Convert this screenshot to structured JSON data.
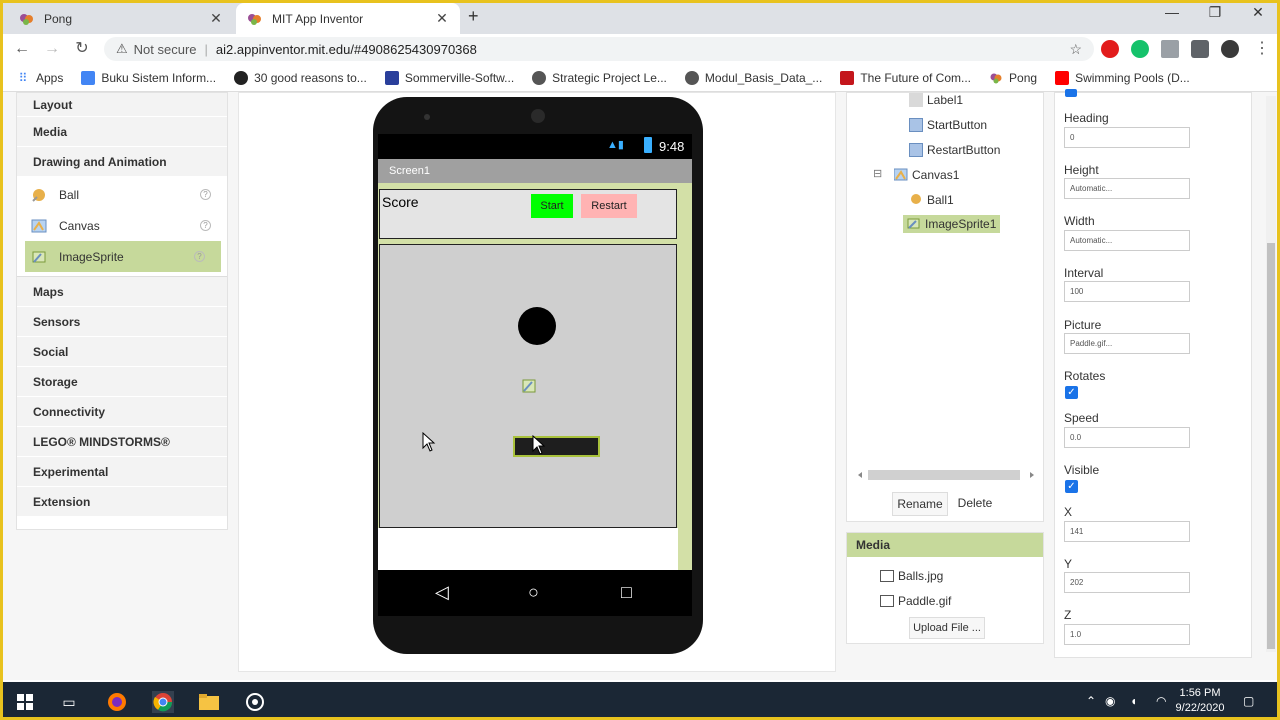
{
  "browser": {
    "tabs": [
      {
        "title": "Pong",
        "active": false
      },
      {
        "title": "MIT App Inventor",
        "active": true
      }
    ],
    "new_tab": "+",
    "window_controls": {
      "minimize": "—",
      "restore": "❐",
      "close": "✕"
    },
    "security_text": "Not secure",
    "url": "ai2.appinventor.mit.edu/#4908625430970368",
    "bookmarks": [
      "Apps",
      "Buku Sistem Inform...",
      "30 good reasons to...",
      "Sommerville-Softw...",
      "Strategic Project Le...",
      "Modul_Basis_Data_...",
      "The Future of Com...",
      "Pong",
      "Swimming Pools (D..."
    ]
  },
  "palette": {
    "categories_top": [
      "Layout",
      "Media",
      "Drawing and Animation"
    ],
    "components": [
      {
        "label": "Ball",
        "icon": "ball-icon",
        "selected": false
      },
      {
        "label": "Canvas",
        "icon": "canvas-icon",
        "selected": false
      },
      {
        "label": "ImageSprite",
        "icon": "imagesprite-icon",
        "selected": true
      }
    ],
    "help_glyph": "?",
    "categories_bottom": [
      "Maps",
      "Sensors",
      "Social",
      "Storage",
      "Connectivity",
      "LEGO® MINDSTORMS®",
      "Experimental",
      "Extension"
    ]
  },
  "phone": {
    "time": "9:48",
    "screen_title": "Screen1",
    "score_label": "Score",
    "start_label": "Start",
    "restart_label": "Restart"
  },
  "tree": {
    "nodes": [
      {
        "label": "Label1",
        "icon": "label-icon"
      },
      {
        "label": "StartButton",
        "icon": "button-icon"
      },
      {
        "label": "RestartButton",
        "icon": "button-icon"
      },
      {
        "label": "Canvas1",
        "icon": "canvas-icon"
      },
      {
        "label": "Ball1",
        "icon": "ball-icon"
      },
      {
        "label": "ImageSprite1",
        "icon": "imagesprite-icon"
      }
    ],
    "collapse_glyph": "⊟",
    "rename_label": "Rename",
    "delete_label": "Delete"
  },
  "media": {
    "title": "Media",
    "files": [
      "Balls.jpg",
      "Paddle.gif"
    ],
    "upload_label": "Upload File ..."
  },
  "properties": {
    "heading_label": "Heading",
    "heading_value": "0",
    "height_label": "Height",
    "height_value": "Automatic...",
    "width_label": "Width",
    "width_value": "Automatic...",
    "interval_label": "Interval",
    "interval_value": "100",
    "picture_label": "Picture",
    "picture_value": "Paddle.gif...",
    "rotates_label": "Rotates",
    "rotates_checked": true,
    "speed_label": "Speed",
    "speed_value": "0.0",
    "visible_label": "Visible",
    "visible_checked": true,
    "x_label": "X",
    "x_value": "141",
    "y_label": "Y",
    "y_value": "202",
    "z_label": "Z",
    "z_value": "1.0"
  },
  "taskbar": {
    "time": "1:56 PM",
    "date": "9/22/2020"
  },
  "colors": {
    "selected_green": "#c6d99b",
    "start_button": "#00ff00",
    "restart_button": "#ffb3b3",
    "canvas": "#cfcfcf",
    "paddle_border": "#a9c23c",
    "chrome_frame": "#e8c21e"
  }
}
